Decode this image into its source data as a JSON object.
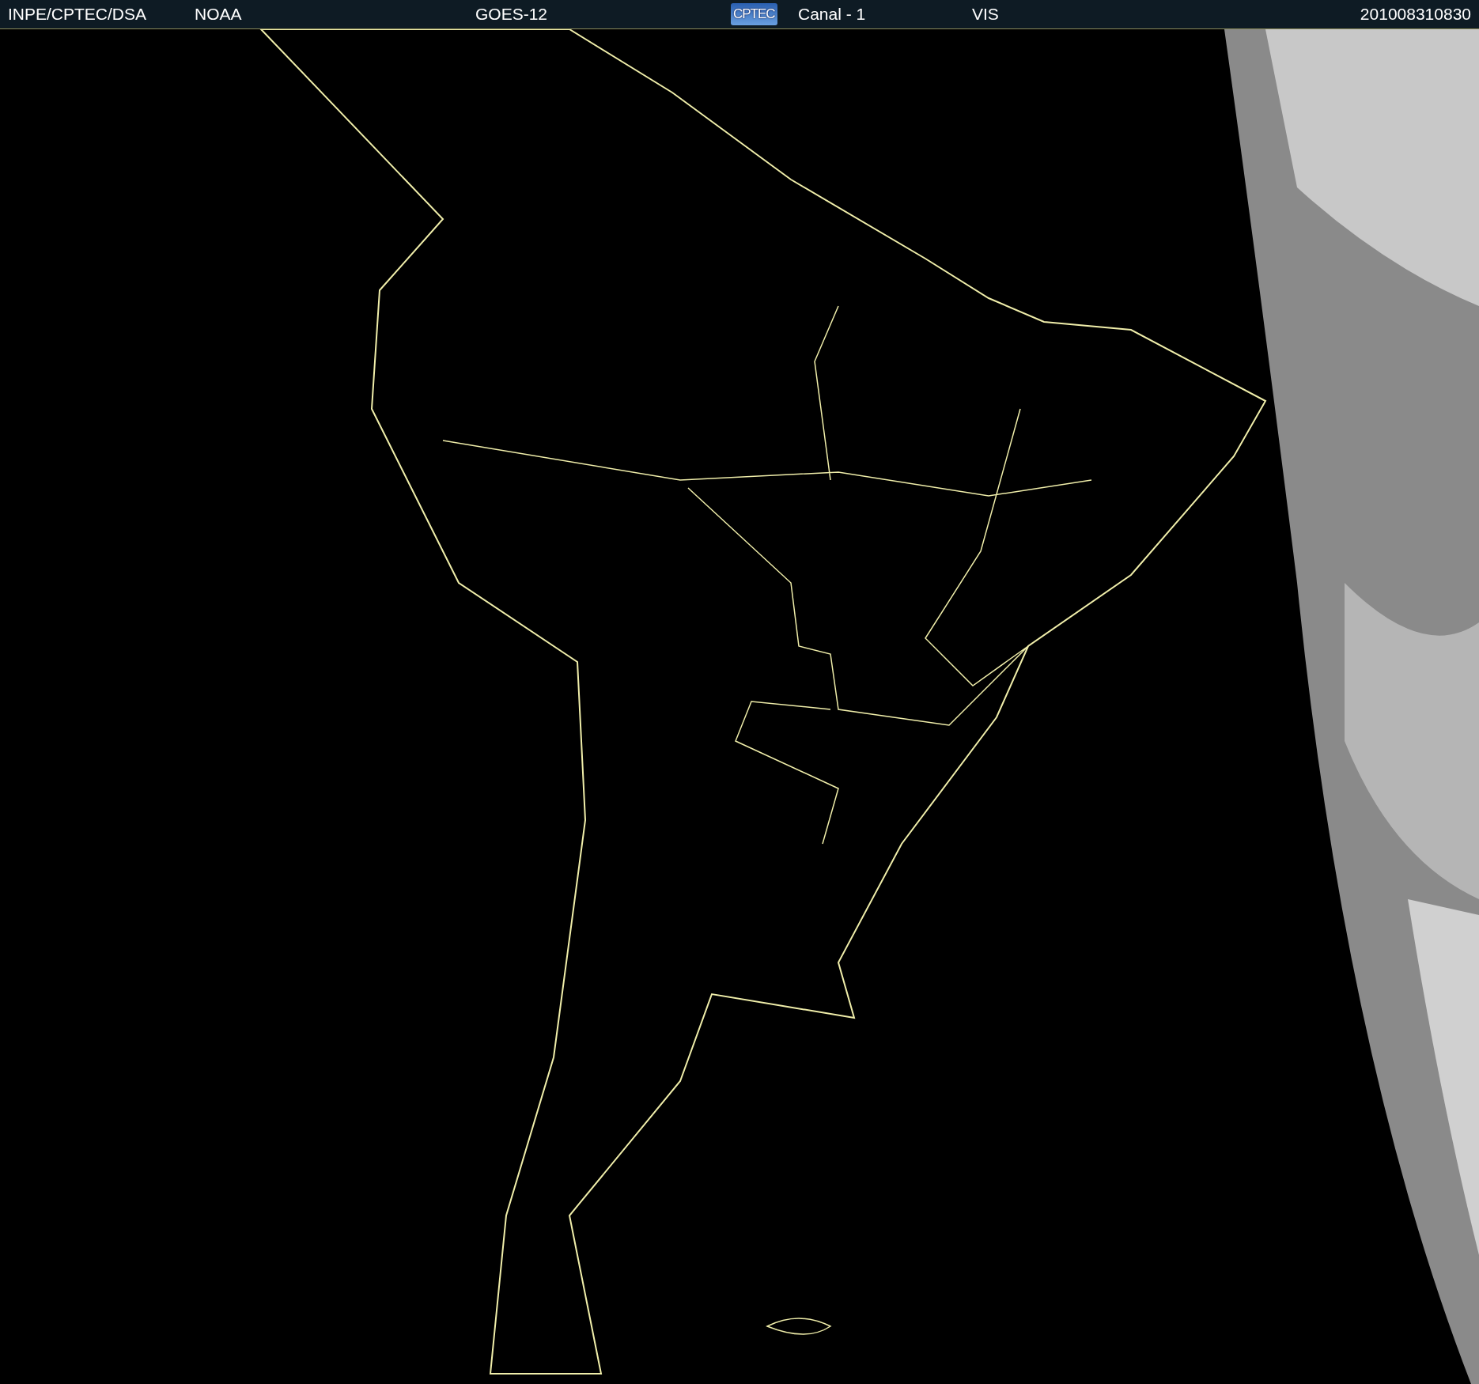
{
  "header": {
    "items": [
      {
        "kind": "text",
        "text": "INPE/CPTEC/DSA"
      },
      {
        "kind": "text",
        "text": "NOAA"
      },
      {
        "kind": "text",
        "text": "GOES-12"
      },
      {
        "kind": "logo",
        "text": "CPTEC"
      },
      {
        "kind": "text",
        "text": "Canal - 1"
      },
      {
        "kind": "text",
        "text": "VIS"
      },
      {
        "kind": "text",
        "text": "201008310830"
      }
    ]
  }
}
